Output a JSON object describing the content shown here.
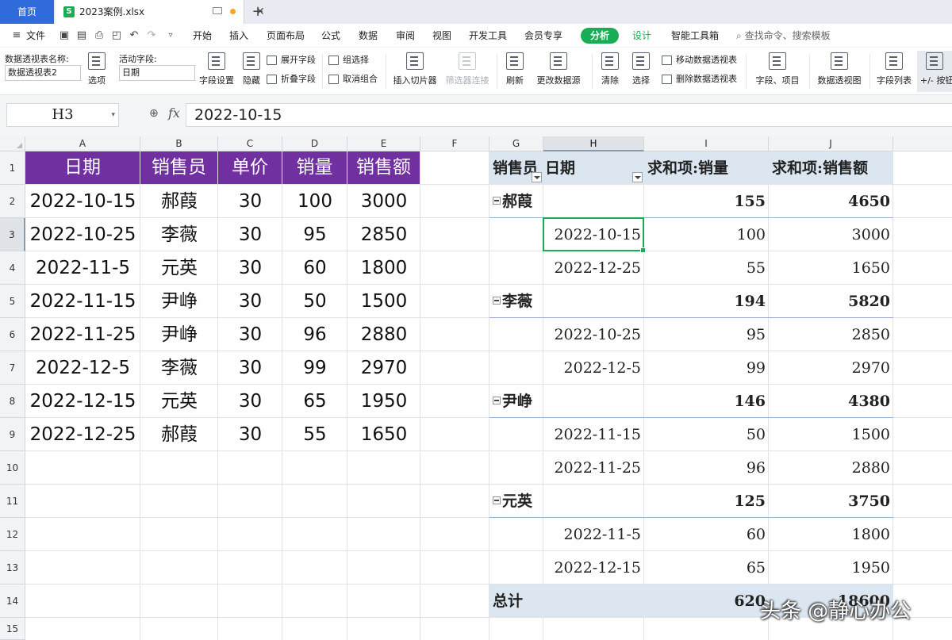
{
  "tabs": {
    "home": "首页",
    "file": "2023案例.xlsx",
    "file_icon": "S"
  },
  "menu": {
    "file": "文件",
    "items": [
      "开始",
      "插入",
      "页面布局",
      "公式",
      "数据",
      "审阅",
      "视图",
      "开发工具",
      "会员专享"
    ],
    "analysis": "分析",
    "design": "设计",
    "smart_tools": "智能工具箱",
    "search": "查找命令、搜索模板"
  },
  "ribbon": {
    "pivot_name_label": "数据透视表名称:",
    "pivot_name_value": "数据透视表2",
    "options": "选项",
    "active_field_label": "活动字段:",
    "active_field_value": "日期",
    "field_settings": "字段设置",
    "hide": "隐藏",
    "expand_field": "展开字段",
    "collapse_field": "折叠字段",
    "group_selection": "组选择",
    "ungroup": "取消组合",
    "insert_slicer": "插入切片器",
    "filter_connections": "筛选器连接",
    "refresh": "刷新",
    "change_source": "更改数据源",
    "clear": "清除",
    "select": "选择",
    "move_pivot": "移动数据透视表",
    "delete_pivot": "删除数据透视表",
    "fields_items": "字段、项目",
    "pivot_chart": "数据透视图",
    "field_list": "字段列表",
    "plus_minus": "+/- 按钮"
  },
  "formula_bar": {
    "cell_ref": "H3",
    "fx": "fx",
    "value": "2022-10-15"
  },
  "columns": [
    "A",
    "B",
    "C",
    "D",
    "E",
    "F",
    "G",
    "H",
    "I",
    "J"
  ],
  "rows": [
    "1",
    "2",
    "3",
    "4",
    "5",
    "6",
    "7",
    "8",
    "9",
    "10",
    "11",
    "12",
    "13",
    "14",
    "15"
  ],
  "source_table": {
    "headers": [
      "日期",
      "销售员",
      "单价",
      "销量",
      "销售额"
    ],
    "rows": [
      [
        "2022-10-15",
        "郝葭",
        "30",
        "100",
        "3000"
      ],
      [
        "2022-10-25",
        "李薇",
        "30",
        "95",
        "2850"
      ],
      [
        "2022-11-5",
        "元英",
        "30",
        "60",
        "1800"
      ],
      [
        "2022-11-15",
        "尹峥",
        "30",
        "50",
        "1500"
      ],
      [
        "2022-11-25",
        "尹峥",
        "30",
        "96",
        "2880"
      ],
      [
        "2022-12-5",
        "李薇",
        "30",
        "99",
        "2970"
      ],
      [
        "2022-12-15",
        "元英",
        "30",
        "65",
        "1950"
      ],
      [
        "2022-12-25",
        "郝葭",
        "30",
        "55",
        "1650"
      ]
    ]
  },
  "pivot": {
    "header": {
      "salesperson": "销售员",
      "date": "日期",
      "sum_qty": "求和项:销量",
      "sum_amount": "求和项:销售额"
    },
    "rows": [
      {
        "kind": "subtotal",
        "label": "郝葭",
        "qty": "155",
        "amount": "4650"
      },
      {
        "kind": "detail",
        "label": "2022-10-15",
        "qty": "100",
        "amount": "3000"
      },
      {
        "kind": "detail",
        "label": "2022-12-25",
        "qty": "55",
        "amount": "1650"
      },
      {
        "kind": "subtotal",
        "label": "李薇",
        "qty": "194",
        "amount": "5820"
      },
      {
        "kind": "detail",
        "label": "2022-10-25",
        "qty": "95",
        "amount": "2850"
      },
      {
        "kind": "detail",
        "label": "2022-12-5",
        "qty": "99",
        "amount": "2970"
      },
      {
        "kind": "subtotal",
        "label": "尹峥",
        "qty": "146",
        "amount": "4380"
      },
      {
        "kind": "detail",
        "label": "2022-11-15",
        "qty": "50",
        "amount": "1500"
      },
      {
        "kind": "detail",
        "label": "2022-11-25",
        "qty": "96",
        "amount": "2880"
      },
      {
        "kind": "subtotal",
        "label": "元英",
        "qty": "125",
        "amount": "3750"
      },
      {
        "kind": "detail",
        "label": "2022-11-5",
        "qty": "60",
        "amount": "1800"
      },
      {
        "kind": "detail",
        "label": "2022-12-15",
        "qty": "65",
        "amount": "1950"
      }
    ],
    "total": {
      "label": "总计",
      "qty": "620",
      "amount": "18600"
    }
  },
  "watermark": "头条 @静心办公",
  "colors": {
    "source_header_bg": "#7030a0",
    "pivot_header_bg": "#dce6f1",
    "accent_green": "#1aad55",
    "home_tab_bg": "#2f6bda"
  }
}
